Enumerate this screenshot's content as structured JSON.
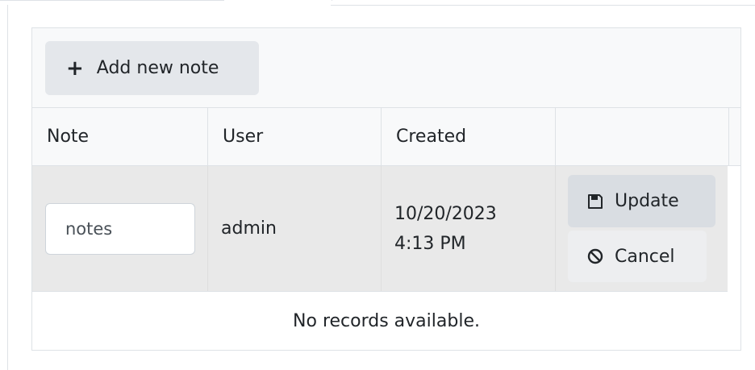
{
  "toolbar": {
    "add_label": "Add new note"
  },
  "columns": [
    {
      "label": "Note"
    },
    {
      "label": "User"
    },
    {
      "label": "Created"
    },
    {
      "label": ""
    }
  ],
  "edit_row": {
    "note_value": "notes",
    "user": "admin",
    "created_date": "10/20/2023",
    "created_time": "4:13 PM",
    "update_label": "Update",
    "cancel_label": "Cancel"
  },
  "empty_message": "No records available.",
  "icons": {
    "add": "plus-icon",
    "update": "save-icon",
    "cancel": "cancel-icon"
  }
}
